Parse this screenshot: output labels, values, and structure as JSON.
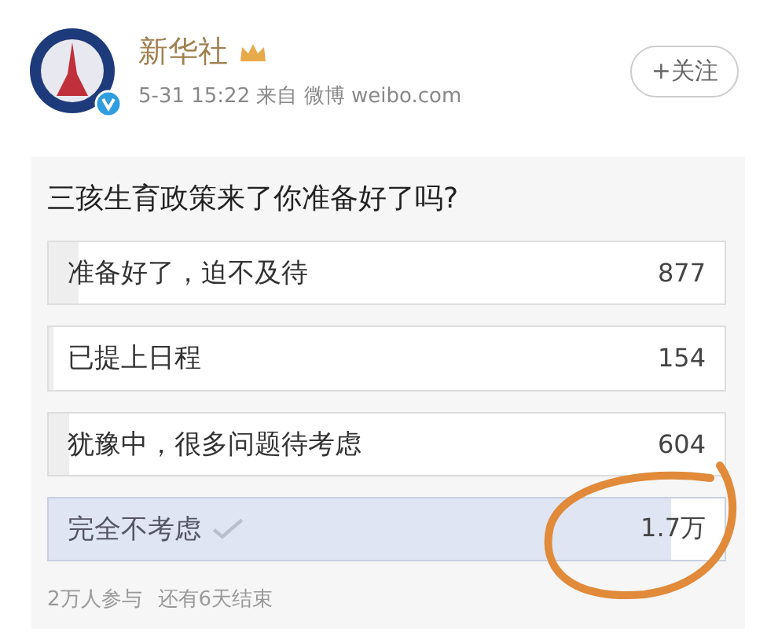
{
  "post": {
    "author": "新华社",
    "meta": "5-31 15:22  来自 微博 weibo.com",
    "follow_button": "+关注",
    "verified": true
  },
  "poll": {
    "question": "三孩生育政策来了你准备好了吗?",
    "options": [
      {
        "label": "准备好了，迫不及待",
        "count": "877",
        "level": 0.045,
        "selected": false
      },
      {
        "label": "已提上日程",
        "count": "154",
        "level": 0.008,
        "selected": false
      },
      {
        "label": "犹豫中，很多问题待考虑",
        "count": "604",
        "level": 0.03,
        "selected": false
      },
      {
        "label": "完全不考虑",
        "count": "1.7万",
        "level": 0.92,
        "selected": true
      }
    ],
    "participants": "2万人参与",
    "remaining": "还有6天结束"
  }
}
